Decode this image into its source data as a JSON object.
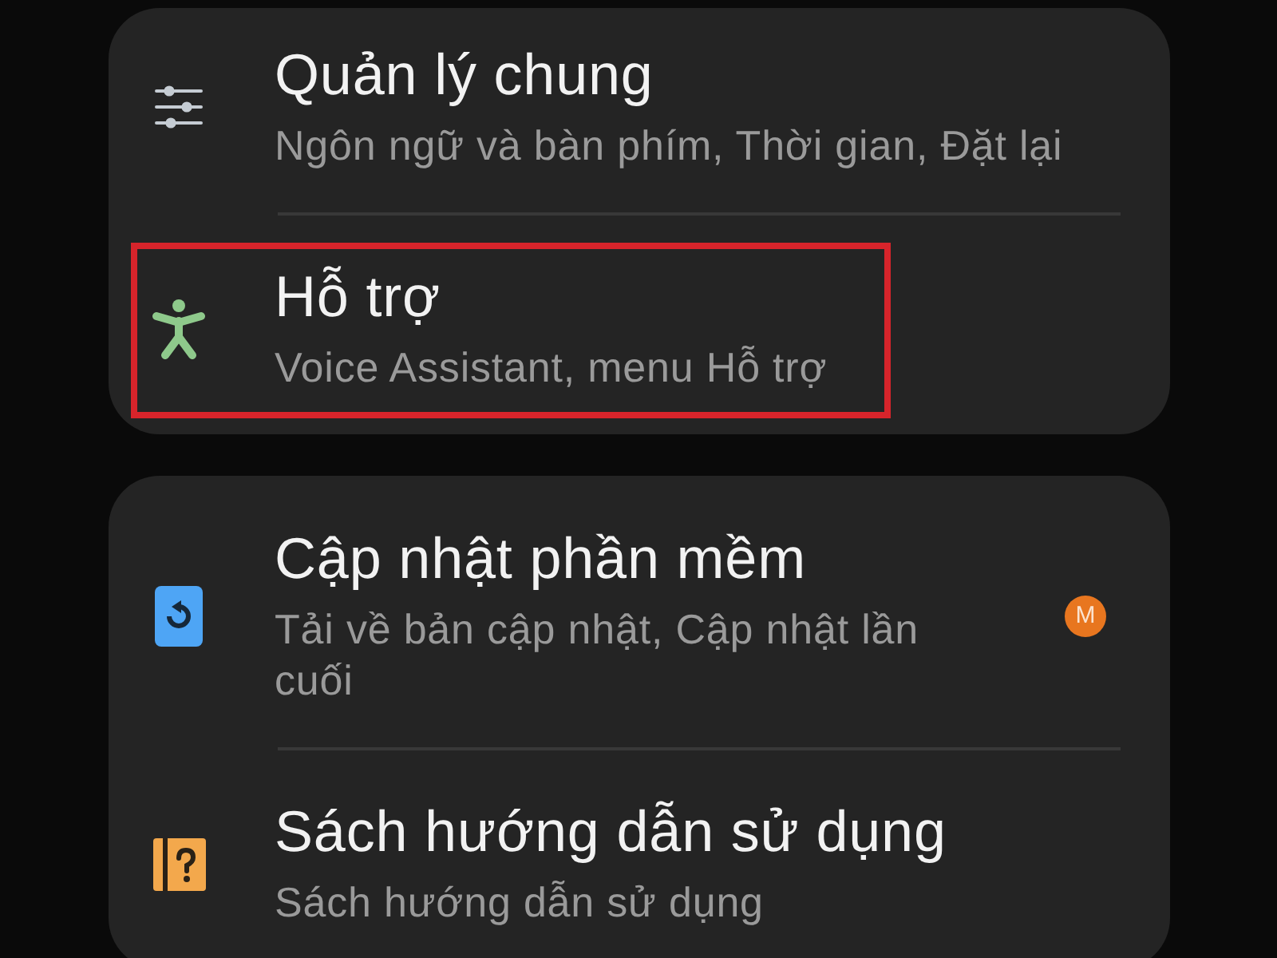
{
  "cards": [
    {
      "items": [
        {
          "kind": "sliders",
          "title": "Quản lý chung",
          "subtitle": "Ngôn ngữ và bàn phím, Thời gian, Đặt lại",
          "highlighted": false
        },
        {
          "kind": "person",
          "title": "Hỗ trợ",
          "subtitle": "Voice Assistant, menu Hỗ trợ",
          "highlighted": true
        }
      ]
    },
    {
      "items": [
        {
          "kind": "update",
          "title": "Cập nhật phần mềm",
          "subtitle": "Tải về bản cập nhật, Cập nhật lần cuối",
          "badge": "M",
          "highlighted": false
        },
        {
          "kind": "manual",
          "title": "Sách hướng dẫn sử dụng",
          "subtitle": "Sách hướng dẫn sử dụng",
          "highlighted": false
        }
      ]
    }
  ]
}
